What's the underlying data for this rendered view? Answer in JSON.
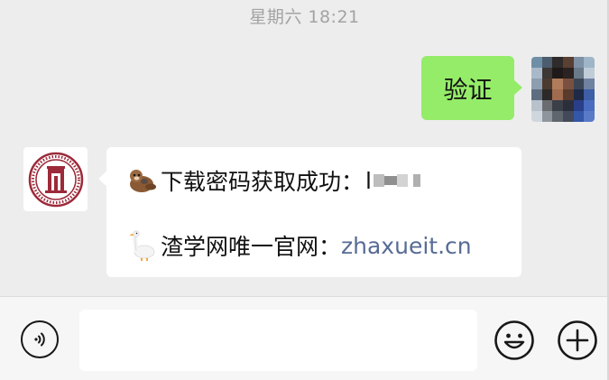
{
  "chat": {
    "timestamp": "星期六 18:21",
    "outgoing": {
      "text": "验证",
      "avatar_icon": "pixelated-avatar"
    },
    "incoming": {
      "avatar_icon": "university-seal-logo",
      "line1_icon": "otter-emoji",
      "line1_text": "下载密码获取成功：",
      "line1_value_visible": "l",
      "line2_icon": "goose-emoji",
      "line2_text": "渣学网唯一官网：",
      "line2_link": "zhaxueit.cn"
    }
  },
  "input_bar": {
    "voice_icon": "voice-icon",
    "text_value": "",
    "emoji_icon": "emoji-icon",
    "plus_icon": "plus-icon"
  },
  "colors": {
    "background": "#ededed",
    "outgoing_bubble": "#95ec69",
    "incoming_bubble": "#ffffff",
    "link": "#576b95",
    "timestamp": "#a3a3a3",
    "input_bar": "#f6f6f6"
  }
}
